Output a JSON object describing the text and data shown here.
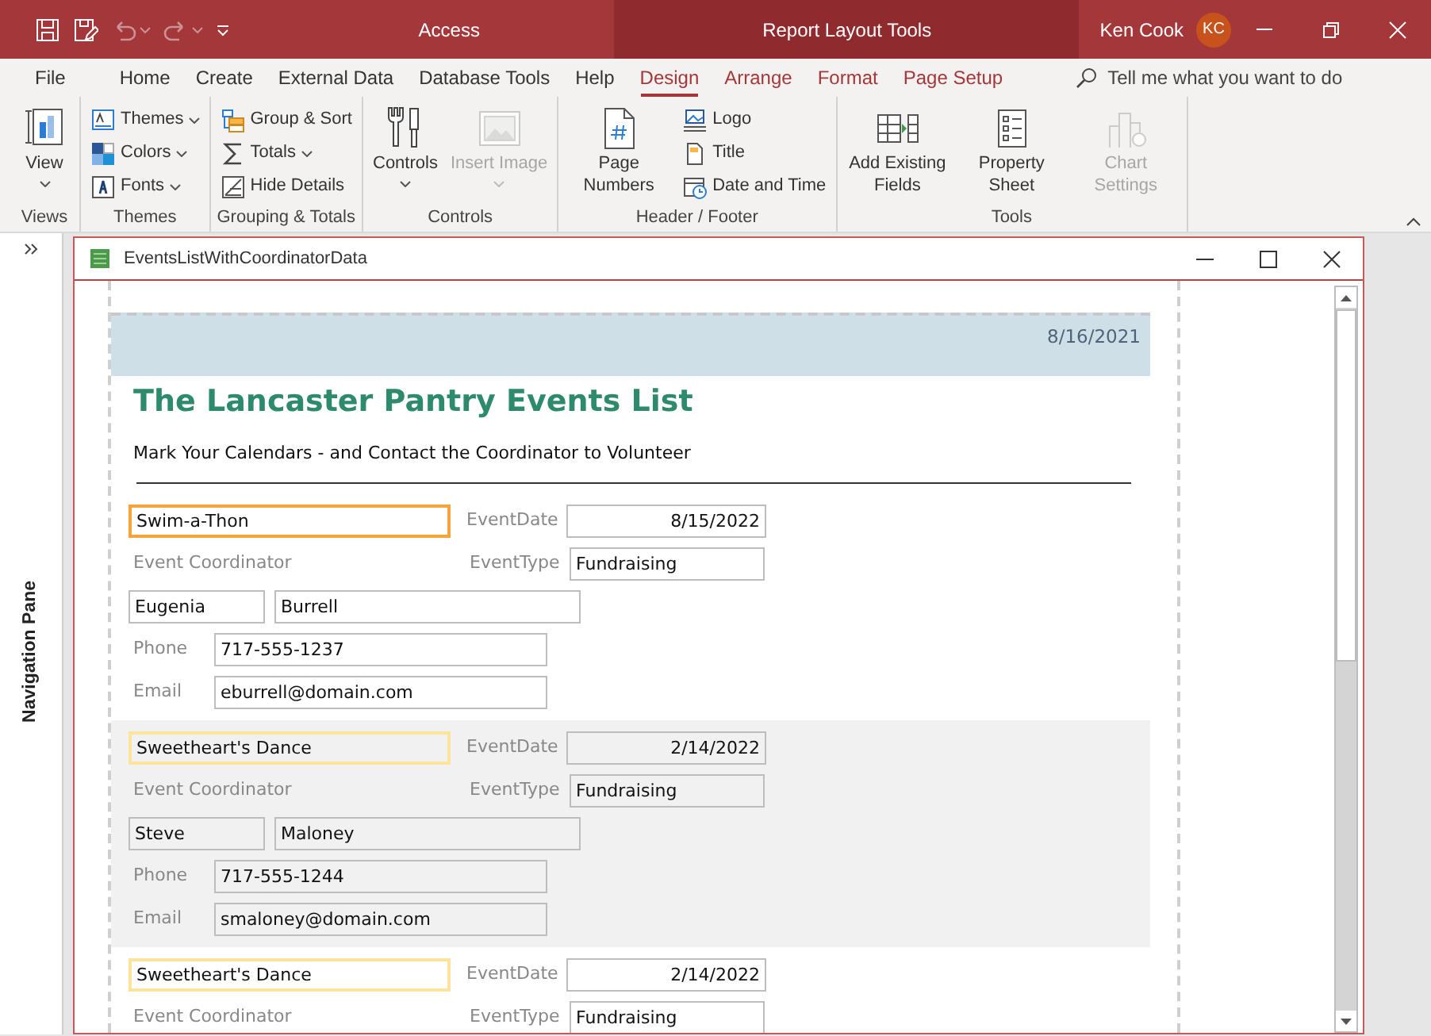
{
  "titlebar": {
    "quick_access": [
      {
        "disabled": false
      },
      {
        "disabled": false
      },
      {
        "disabled": true
      },
      {
        "disabled": true
      }
    ],
    "app_title": "Access",
    "context_title": "Report Layout Tools",
    "user_name": "Ken Cook",
    "user_initials": "KC"
  },
  "tabs": [
    {
      "label": "File",
      "selected": false,
      "contextual": false
    },
    {
      "label": "Home",
      "selected": false,
      "contextual": false
    },
    {
      "label": "Create",
      "selected": false,
      "contextual": false
    },
    {
      "label": "External Data",
      "selected": false,
      "contextual": false
    },
    {
      "label": "Database Tools",
      "selected": false,
      "contextual": false
    },
    {
      "label": "Help",
      "selected": false,
      "contextual": false
    },
    {
      "label": "Design",
      "selected": true,
      "contextual": true
    },
    {
      "label": "Arrange",
      "selected": false,
      "contextual": true
    },
    {
      "label": "Format",
      "selected": false,
      "contextual": true
    },
    {
      "label": "Page Setup",
      "selected": false,
      "contextual": true
    }
  ],
  "tell_me": {
    "placeholder": "Tell me what you want to do"
  },
  "ribbon_groups": [
    {
      "label": "Views",
      "items": [
        {
          "label": "View",
          "kind": "large",
          "dropdown": true,
          "disabled": false
        }
      ]
    },
    {
      "label": "Themes",
      "items": [
        {
          "label": "Themes",
          "kind": "small",
          "dropdown": true,
          "disabled": false
        },
        {
          "label": "Colors",
          "kind": "small",
          "dropdown": true,
          "disabled": false
        },
        {
          "label": "Fonts",
          "kind": "small",
          "dropdown": true,
          "disabled": false
        }
      ]
    },
    {
      "label": "Grouping & Totals",
      "items": [
        {
          "label": "Group & Sort",
          "kind": "small",
          "dropdown": false,
          "disabled": false
        },
        {
          "label": "Totals",
          "kind": "small",
          "dropdown": true,
          "disabled": false
        },
        {
          "label": "Hide Details",
          "kind": "small",
          "dropdown": false,
          "disabled": false
        }
      ]
    },
    {
      "label": "Controls",
      "items": [
        {
          "label": "Controls",
          "kind": "large",
          "dropdown": true,
          "disabled": false
        },
        {
          "label": "Insert Image",
          "kind": "large",
          "dropdown": true,
          "disabled": true
        }
      ]
    },
    {
      "label": "Header / Footer",
      "items": [
        {
          "label": "Page Numbers",
          "kind": "large",
          "dropdown": false,
          "disabled": false
        },
        {
          "label": "Logo",
          "kind": "small",
          "dropdown": false,
          "disabled": false
        },
        {
          "label": "Title",
          "kind": "small",
          "dropdown": false,
          "disabled": false
        },
        {
          "label": "Date and Time",
          "kind": "small",
          "dropdown": false,
          "disabled": false
        }
      ]
    },
    {
      "label": "Tools",
      "items": [
        {
          "label": "Add Existing Fields",
          "kind": "large",
          "dropdown": false,
          "disabled": false
        },
        {
          "label": "Property Sheet",
          "kind": "large",
          "dropdown": false,
          "disabled": false
        },
        {
          "label": "Chart Settings",
          "kind": "large",
          "dropdown": false,
          "disabled": true
        }
      ]
    }
  ],
  "navigation_pane": {
    "label": "Navigation Pane"
  },
  "document": {
    "title": "EventsListWithCoordinatorData",
    "report": {
      "date": "8/16/2021",
      "title": "The Lancaster Pantry Events List",
      "subtitle": "Mark Your Calendars - and Contact the Coordinator to Volunteer",
      "records": [
        {
          "selected": true,
          "shaded": false,
          "event_name": "Swim-a-Thon",
          "date_label": "EventDate",
          "date": "8/15/2022",
          "coordinator_label": "Event Coordinator",
          "type_label": "EventType",
          "type": "Fundraising",
          "first_name": "Eugenia",
          "last_name": "Burrell",
          "phone_label": "Phone",
          "phone": "717-555-1237",
          "email_label": "Email",
          "email": "eburrell@domain.com"
        },
        {
          "selected": false,
          "shaded": true,
          "event_name": "Sweetheart's Dance",
          "date_label": "EventDate",
          "date": "2/14/2022",
          "coordinator_label": "Event Coordinator",
          "type_label": "EventType",
          "type": "Fundraising",
          "first_name": "Steve",
          "last_name": "Maloney",
          "phone_label": "Phone",
          "phone": "717-555-1244",
          "email_label": "Email",
          "email": "smaloney@domain.com"
        },
        {
          "selected": false,
          "shaded": false,
          "event_name": "Sweetheart's Dance",
          "date_label": "EventDate",
          "date": "2/14/2022",
          "coordinator_label": "Event Coordinator",
          "type_label": "EventType",
          "type": "Fundraising"
        }
      ]
    }
  }
}
